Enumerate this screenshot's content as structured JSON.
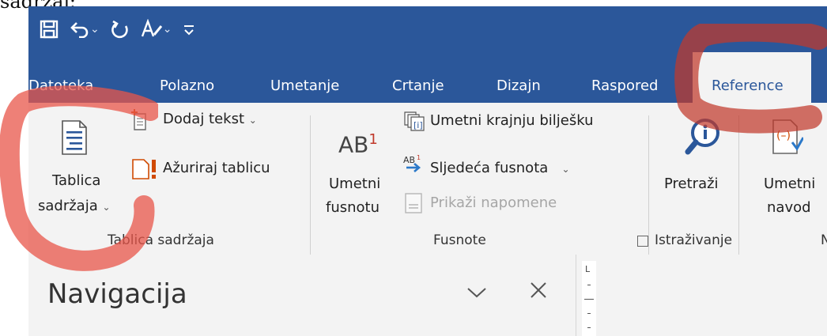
{
  "caption": "sadržaj:",
  "qat": {
    "save_icon": "save-icon",
    "undo_icon": "undo-icon",
    "redo_icon": "redo-icon",
    "format_icon": "format-painter-icon",
    "customize_icon": "customize-qat-icon",
    "chevron": "⌄"
  },
  "tabs": [
    {
      "label": "Datoteka"
    },
    {
      "label": "Polazno"
    },
    {
      "label": "Umetanje"
    },
    {
      "label": "Crtanje"
    },
    {
      "label": "Dizajn"
    },
    {
      "label": "Raspored"
    },
    {
      "label": "Reference"
    }
  ],
  "toc_group": {
    "big_button_line1": "Tablica",
    "big_button_line2": "sadržaja",
    "add_text": "Dodaj tekst",
    "update_table": "Ažuriraj tablicu",
    "group_label": "Tablica sadržaja"
  },
  "footnotes_group": {
    "insert_footnote_line1": "Umetni",
    "insert_footnote_line2": "fusnotu",
    "ab_label": "AB",
    "superscript": "1",
    "insert_endnote": "Umetni krajnju bilješku",
    "next_footnote": "Sljedeća fusnota",
    "show_notes": "Prikaži napomene",
    "group_label": "Fusnote"
  },
  "research_group": {
    "search": "Pretraži",
    "group_label": "Istraživanje"
  },
  "citations_group": {
    "insert_citation_line1": "Umetni",
    "insert_citation_line2": "navod",
    "group_label_partial": "N"
  },
  "nav_pane": {
    "title": "Navigacija",
    "ruler_mark": "L"
  },
  "colors": {
    "title_bar": "#2b579a",
    "ribbon": "#f3f3f3",
    "annotation": "#e8554a"
  }
}
